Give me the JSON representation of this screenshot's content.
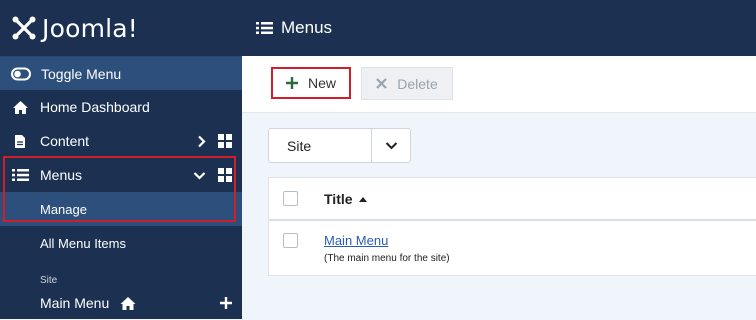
{
  "brand": {
    "name": "Joomla!"
  },
  "sidebar": {
    "toggle_label": "Toggle Menu",
    "items": [
      {
        "label": "Home Dashboard",
        "icon": "home-icon"
      },
      {
        "label": "Content",
        "icon": "file-icon"
      },
      {
        "label": "Menus",
        "icon": "list-icon"
      }
    ],
    "submenu": [
      {
        "label": "Manage"
      },
      {
        "label": "All Menu Items"
      }
    ],
    "section_label": "Site",
    "site_menu_label": "Main Menu"
  },
  "header": {
    "title": "Menus"
  },
  "toolbar": {
    "new_label": "New",
    "delete_label": "Delete"
  },
  "filter": {
    "selected": "Site"
  },
  "table": {
    "columns": {
      "title": "Title"
    },
    "rows": [
      {
        "title": "Main Menu",
        "description": "(The main menu for the site)"
      }
    ]
  },
  "colors": {
    "sidebar_bg": "#1c3152",
    "active_bg": "#2c4f7c",
    "highlight": "#d01f2a",
    "link": "#2a5db0"
  }
}
